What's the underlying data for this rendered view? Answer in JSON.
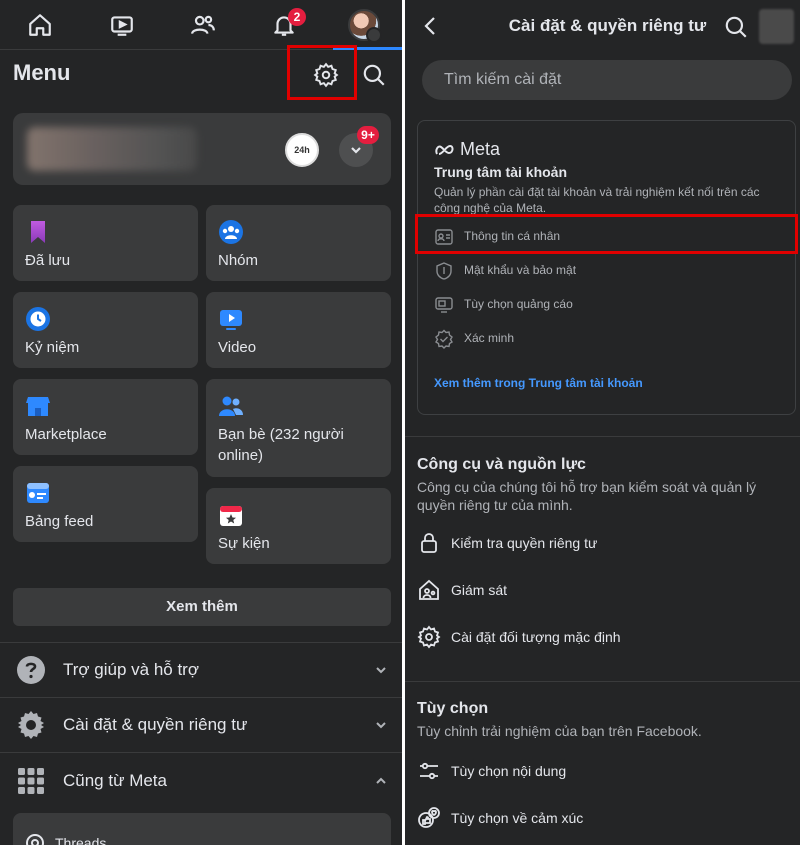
{
  "left": {
    "nav": {
      "notifications_badge": "2"
    },
    "menu_title": "Menu",
    "profile": {
      "notifications_badge": "9+",
      "page_avatar_text": "24h"
    },
    "shortcuts_col1": [
      {
        "label": "Đã lưu"
      },
      {
        "label": "Kỷ niệm"
      },
      {
        "label": "Marketplace"
      },
      {
        "label": "Bảng feed"
      }
    ],
    "shortcuts_col2": [
      {
        "label": "Nhóm"
      },
      {
        "label": "Video"
      },
      {
        "label": "Bạn bè (232 người online)"
      },
      {
        "label": "Sự kiện"
      }
    ],
    "see_more": "Xem thêm",
    "sections": [
      {
        "label": "Trợ giúp và hỗ trợ"
      },
      {
        "label": "Cài đặt & quyền riêng tư"
      },
      {
        "label": "Cũng từ Meta"
      }
    ],
    "threads_label": "Threads"
  },
  "right": {
    "header_title": "Cài đặt & quyền riêng tư",
    "search_placeholder": "Tìm kiếm cài đặt",
    "meta_card": {
      "logo": "Meta",
      "title": "Trung tâm tài khoản",
      "description": "Quản lý phần cài đặt tài khoản và trải nghiệm kết nối trên các công nghệ của Meta.",
      "items": [
        {
          "label": "Thông tin cá nhân"
        },
        {
          "label": "Mật khẩu và bảo mật"
        },
        {
          "label": "Tùy chọn quảng cáo"
        },
        {
          "label": "Xác minh"
        }
      ],
      "link": "Xem thêm trong Trung tâm tài khoản"
    },
    "tools": {
      "title": "Công cụ và nguồn lực",
      "description": "Công cụ của chúng tôi hỗ trợ bạn kiểm soát và quản lý quyền riêng tư của mình.",
      "items": [
        {
          "label": "Kiểm tra quyền riêng tư"
        },
        {
          "label": "Giám sát"
        },
        {
          "label": "Cài đặt đối tượng mặc định"
        }
      ]
    },
    "options": {
      "title": "Tùy chọn",
      "description": "Tùy chỉnh trải nghiệm của bạn trên Facebook.",
      "items": [
        {
          "label": "Tùy chọn nội dung"
        },
        {
          "label": "Tùy chọn về cảm xúc"
        }
      ]
    }
  },
  "colors": {
    "background": "#242526",
    "card": "#3a3b3c",
    "accent": "#2d88ff",
    "link": "#4599ff",
    "highlight": "#e00000",
    "badge": "#e41e3f"
  }
}
